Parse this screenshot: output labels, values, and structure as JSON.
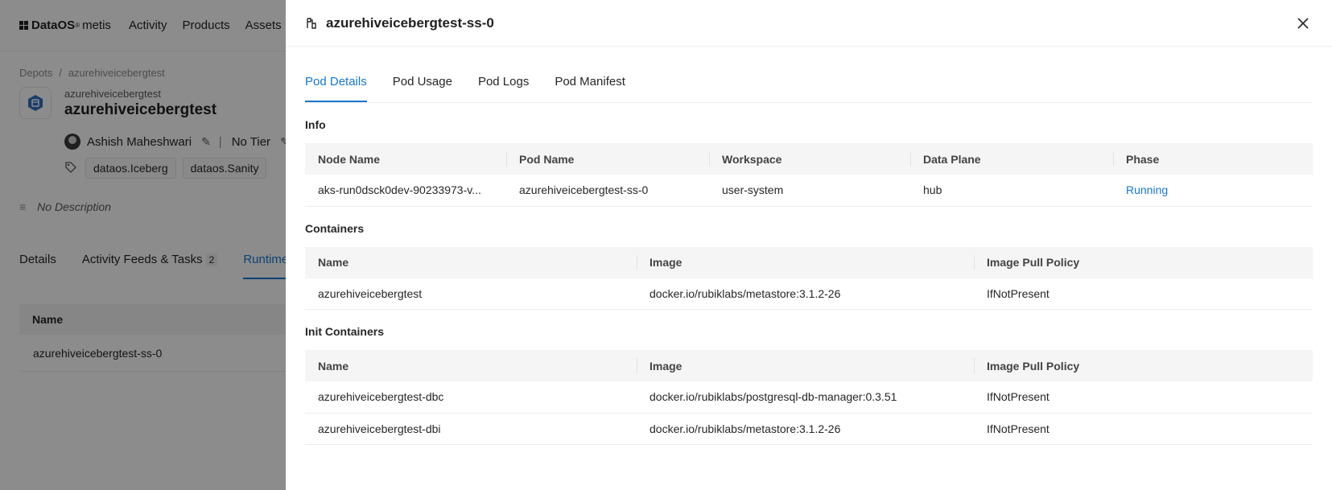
{
  "background": {
    "logo": {
      "brand": "DataOS",
      "reg": "®",
      "product": "metis"
    },
    "nav": [
      "Activity",
      "Products",
      "Assets"
    ],
    "breadcrumb": [
      "Depots",
      "azurehiveicebergtest"
    ],
    "entity": {
      "subtitle": "azurehiveicebergtest",
      "title": "azurehiveicebergtest",
      "owner": "Ashish Maheshwari",
      "tier": "No Tier",
      "tags": [
        "dataos.Iceberg",
        "dataos.Sanity"
      ],
      "description": "No Description"
    },
    "tabs": [
      {
        "label": "Details"
      },
      {
        "label": "Activity Feeds & Tasks",
        "badge": "2"
      },
      {
        "label": "Runtime"
      }
    ],
    "table": {
      "header": "Name",
      "row": "azurehiveicebergtest-ss-0"
    }
  },
  "drawer": {
    "title": "azurehiveicebergtest-ss-0",
    "tabs": [
      "Pod Details",
      "Pod Usage",
      "Pod Logs",
      "Pod Manifest"
    ],
    "info": {
      "title": "Info",
      "headers": [
        "Node Name",
        "Pod Name",
        "Workspace",
        "Data Plane",
        "Phase"
      ],
      "row": [
        "aks-run0dsck0dev-90233973-v...",
        "azurehiveicebergtest-ss-0",
        "user-system",
        "hub",
        "Running"
      ]
    },
    "containers": {
      "title": "Containers",
      "headers": [
        "Name",
        "Image",
        "Image Pull Policy"
      ],
      "rows": [
        [
          "azurehiveicebergtest",
          "docker.io/rubiklabs/metastore:3.1.2-26",
          "IfNotPresent"
        ]
      ]
    },
    "init_containers": {
      "title": "Init Containers",
      "headers": [
        "Name",
        "Image",
        "Image Pull Policy"
      ],
      "rows": [
        [
          "azurehiveicebergtest-dbc",
          "docker.io/rubiklabs/postgresql-db-manager:0.3.51",
          "IfNotPresent"
        ],
        [
          "azurehiveicebergtest-dbi",
          "docker.io/rubiklabs/metastore:3.1.2-26",
          "IfNotPresent"
        ]
      ]
    }
  },
  "colors": {
    "accent": "#1677d2",
    "overlay": "rgba(0,0,0,0.45)"
  }
}
